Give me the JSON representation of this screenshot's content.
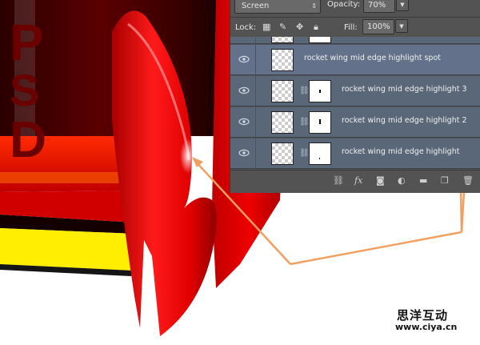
{
  "layers_panel": {
    "blend_mode": "Screen",
    "opacity_label": "Opacity:",
    "opacity_value": "70%",
    "lock_label": "Lock:",
    "fill_label": "Fill:",
    "fill_value": "100%",
    "layers": [
      {
        "name": "rocket wing mid edge highlight spot",
        "has_mask": false,
        "selected": true
      },
      {
        "name": "rocket wing mid edge highlight 3",
        "has_mask": true,
        "selected": false
      },
      {
        "name": "rocket wing mid edge highlight 2",
        "has_mask": true,
        "selected": false
      },
      {
        "name": "rocket wing mid edge highlight",
        "has_mask": true,
        "selected": false
      }
    ],
    "toolbar_icons": [
      "link-icon",
      "fx-icon",
      "mask-icon",
      "adjustment-icon",
      "folder-icon",
      "new-layer-icon",
      "trash-icon"
    ]
  },
  "artwork": {
    "letters": [
      "P",
      "S",
      "D"
    ],
    "colors": {
      "rocket_red": "#e00000",
      "dark_red": "#3a0000",
      "yellow": "#ffee00",
      "arrow": "#f0a060"
    }
  },
  "watermark": {
    "line1": "思洋互动",
    "line2": "www.ciya.cn"
  }
}
